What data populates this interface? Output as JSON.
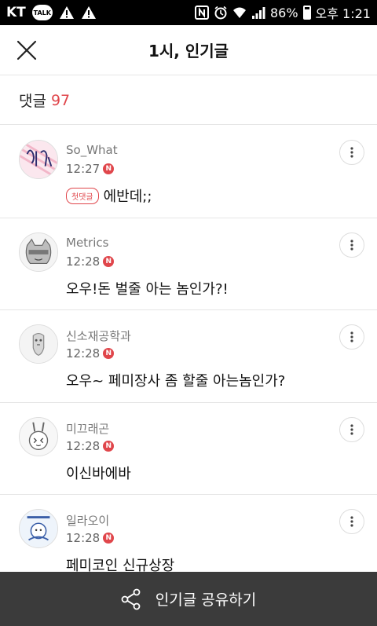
{
  "status_bar": {
    "carrier": "KT",
    "talk_badge": "TALK",
    "battery": "86%",
    "time": "오후 1:21"
  },
  "header": {
    "title": "1시, 인기글",
    "close_icon": "close-icon"
  },
  "comment_count": {
    "label": "댓글",
    "count": "97"
  },
  "comments": [
    {
      "user": "So_What",
      "time": "12:27",
      "first_tag": "첫댓글",
      "text": "에반데;;"
    },
    {
      "user": "Metrics",
      "time": "12:28",
      "text": "오우!돈 벌줄 아는 놈인가?!"
    },
    {
      "user": "신소재공학과",
      "time": "12:28",
      "text": "오우~ 페미장사 좀 할줄 아는놈인가?"
    },
    {
      "user": "미끄래곤",
      "time": "12:28",
      "text": "이신바에바"
    },
    {
      "user": "일라오이",
      "time": "12:28",
      "text": "페미코인 신규상장"
    }
  ],
  "new_badge": "N",
  "share": {
    "label": "인기글 공유하기",
    "icon": "share-icon"
  },
  "colors": {
    "accent": "#e0464b",
    "share_bar": "#3b3b3b"
  }
}
